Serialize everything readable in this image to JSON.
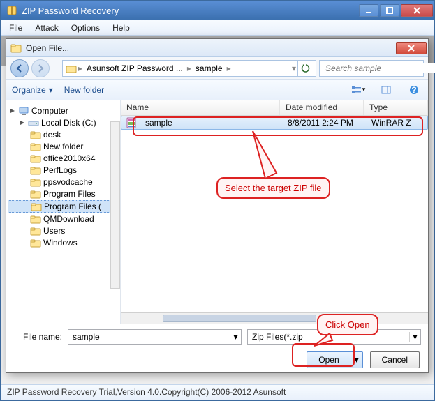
{
  "main_window": {
    "title": "ZIP Password Recovery",
    "menus": [
      "File",
      "Attack",
      "Options",
      "Help"
    ],
    "status": "ZIP Password Recovery Trial,Version 4.0.Copyright(C) 2006-2012 Asunsoft"
  },
  "dialog": {
    "title": "Open File...",
    "breadcrumb": [
      "Asunsoft ZIP Password ...",
      "sample"
    ],
    "search_placeholder": "Search sample",
    "toolbar": {
      "organize": "Organize",
      "new_folder": "New folder"
    },
    "tree": {
      "root": "Computer",
      "drive": "Local Disk (C:)",
      "folders": [
        "desk",
        "New folder",
        "office2010x64",
        "PerfLogs",
        "ppsvodcache",
        "Program Files",
        "Program Files (",
        "QMDownload",
        "Users",
        "Windows"
      ]
    },
    "columns": {
      "name": "Name",
      "date": "Date modified",
      "type": "Type"
    },
    "rows": [
      {
        "name": "sample",
        "date": "8/8/2011 2:24 PM",
        "type": "WinRAR Z"
      }
    ],
    "filename_label": "File name:",
    "filename_value": "sample",
    "filter": "Zip Files(*.zip",
    "open": "Open",
    "cancel": "Cancel"
  },
  "annotations": {
    "select": "Select the target ZIP file",
    "click_open": "Click Open"
  }
}
